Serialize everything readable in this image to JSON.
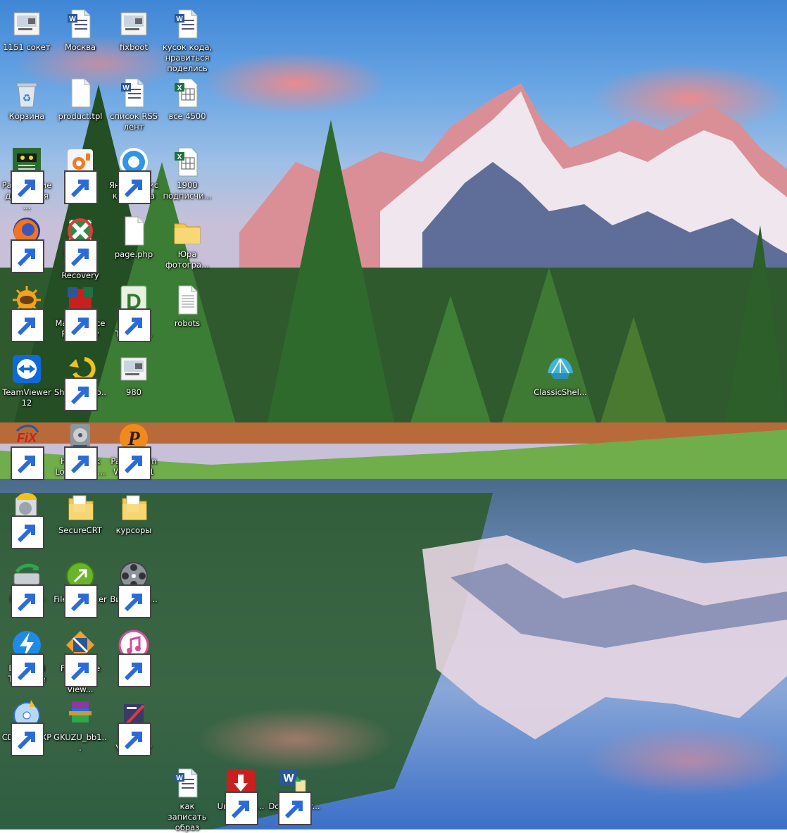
{
  "desktop": {
    "icons": [
      {
        "label": "1151 сокет",
        "icon": "image-thumb-icon",
        "shortcut": false
      },
      {
        "label": "Москва",
        "icon": "word-doc-icon",
        "shortcut": false
      },
      {
        "label": "fixboot",
        "icon": "image-thumb-icon",
        "shortcut": false
      },
      {
        "label": "кусок кода, нравиться поделись",
        "icon": "word-doc-icon",
        "shortcut": false
      },
      {
        "label": "Корзина",
        "icon": "recycle-bin-icon",
        "shortcut": false
      },
      {
        "label": "product.tpl",
        "icon": "blank-file-icon",
        "shortcut": false
      },
      {
        "label": "список RSS лент",
        "icon": "word-doc-icon",
        "shortcut": false
      },
      {
        "label": "все 4500",
        "icon": "excel-doc-icon",
        "shortcut": false
      },
      {
        "label": "Расписание движения ...",
        "icon": "schedule-app-icon",
        "shortcut": true
      },
      {
        "label": "oCam",
        "icon": "ocam-icon",
        "shortcut": true
      },
      {
        "label": "Яндекс.Диск 2.0 бета",
        "icon": "yandex-disk-icon",
        "shortcut": true
      },
      {
        "label": "1900 подписчи...",
        "icon": "excel-doc-icon",
        "shortcut": false
      },
      {
        "label": "Mozilla Firefox",
        "icon": "firefox-icon",
        "shortcut": true
      },
      {
        "label": "Hetman Excel Recovery",
        "icon": "hetman-excel-icon",
        "shortcut": true
      },
      {
        "label": "page.php",
        "icon": "blank-file-icon",
        "shortcut": false
      },
      {
        "label": "Юра фотогра...",
        "icon": "folder-icon",
        "shortcut": false
      },
      {
        "label": "XnView",
        "icon": "xnview-icon",
        "shortcut": true
      },
      {
        "label": "Magic Office Recovery",
        "icon": "magic-office-icon",
        "shortcut": true
      },
      {
        "label": "DWG TrueVie...",
        "icon": "dwg-icon",
        "shortcut": true
      },
      {
        "label": "robots",
        "icon": "text-file-icon",
        "shortcut": false
      },
      {
        "label": "TeamViewer 12",
        "icon": "teamviewer-icon",
        "shortcut": false
      },
      {
        "label": "ShadowExp...",
        "icon": "shadow-explorer-icon",
        "shortcut": true
      },
      {
        "label": "980",
        "icon": "image-thumb-icon",
        "shortcut": false
      },
      {
        "label": "ClassicShel...",
        "icon": "classic-shell-icon",
        "shortcut": false
      },
      {
        "label": "UsbFix",
        "icon": "usbfix-icon",
        "shortcut": true
      },
      {
        "label": "Hard Disk Low Level ...",
        "icon": "hard-disk-icon",
        "shortcut": true
      },
      {
        "label": "Pascal Coin Wallet 2.1",
        "icon": "pascal-coin-icon",
        "shortcut": true
      },
      {
        "label": "Recuva",
        "icon": "recuva-icon",
        "shortcut": true
      },
      {
        "label": "SecureCRT",
        "icon": "folder-doc-icon",
        "shortcut": false
      },
      {
        "label": "курсоры",
        "icon": "folder-doc-icon",
        "shortcut": false
      },
      {
        "label": "R-Studio",
        "icon": "r-studio-icon",
        "shortcut": true
      },
      {
        "label": "FileOptimizer",
        "icon": "file-optimizer-icon",
        "shortcut": true
      },
      {
        "label": "ВидеоМО...",
        "icon": "film-reel-icon",
        "shortcut": true
      },
      {
        "label": "DAEMON Tools Lite",
        "icon": "daemon-tools-icon",
        "shortcut": true
      },
      {
        "label": "FastStone Image View...",
        "icon": "faststone-icon",
        "shortcut": true
      },
      {
        "label": "iTunes",
        "icon": "itunes-icon",
        "shortcut": true
      },
      {
        "label": "CDBurnerXP",
        "icon": "cdburner-icon",
        "shortcut": true
      },
      {
        "label": "GKUZU_bb1...",
        "icon": "winrar-icon",
        "shortcut": false
      },
      {
        "label": "MailList Validator",
        "icon": "maillist-icon",
        "shortcut": true
      },
      {
        "label": "как записать образ",
        "icon": "word-doc-icon",
        "shortcut": false
      },
      {
        "label": "UmmyVid...",
        "icon": "ummy-icon",
        "shortcut": true
      },
      {
        "label": "DocConver...",
        "icon": "docconverter-icon",
        "shortcut": true
      }
    ]
  }
}
